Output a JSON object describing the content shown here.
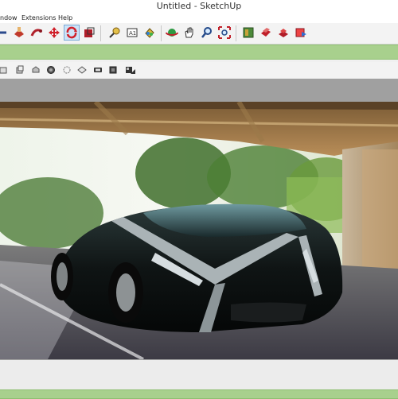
{
  "window": {
    "title": "Untitled - SketchUp"
  },
  "menu": {
    "items": [
      "ndow",
      "Extensions",
      "Help"
    ]
  },
  "toolbar": {
    "buttons": [
      {
        "name": "tape-measure-icon"
      },
      {
        "name": "push-pull-icon"
      },
      {
        "name": "follow-me-icon"
      },
      {
        "name": "move-icon"
      },
      {
        "name": "rotate-icon",
        "active": true
      },
      {
        "name": "scale-icon"
      },
      {
        "name": "dimension-icon"
      },
      {
        "name": "text-icon"
      },
      {
        "name": "paint-bucket-icon"
      },
      {
        "name": "orbit-icon"
      },
      {
        "name": "pan-icon"
      },
      {
        "name": "zoom-icon"
      },
      {
        "name": "zoom-extents-icon"
      },
      {
        "name": "3d-warehouse-icon"
      },
      {
        "name": "extension-warehouse-icon"
      },
      {
        "name": "components-icon"
      },
      {
        "name": "send-to-layout-icon"
      }
    ]
  },
  "view_toolbar": {
    "buttons": [
      "iso-view-icon",
      "top-view-icon",
      "front-view-icon",
      "xray-icon",
      "back-edges-icon",
      "wireframe-icon",
      "hidden-line-icon",
      "shaded-icon",
      "shaded-textures-icon",
      "monochrome-icon"
    ]
  },
  "colors": {
    "accent_green": "#a8d08d",
    "active_button": "#cde3f7"
  }
}
